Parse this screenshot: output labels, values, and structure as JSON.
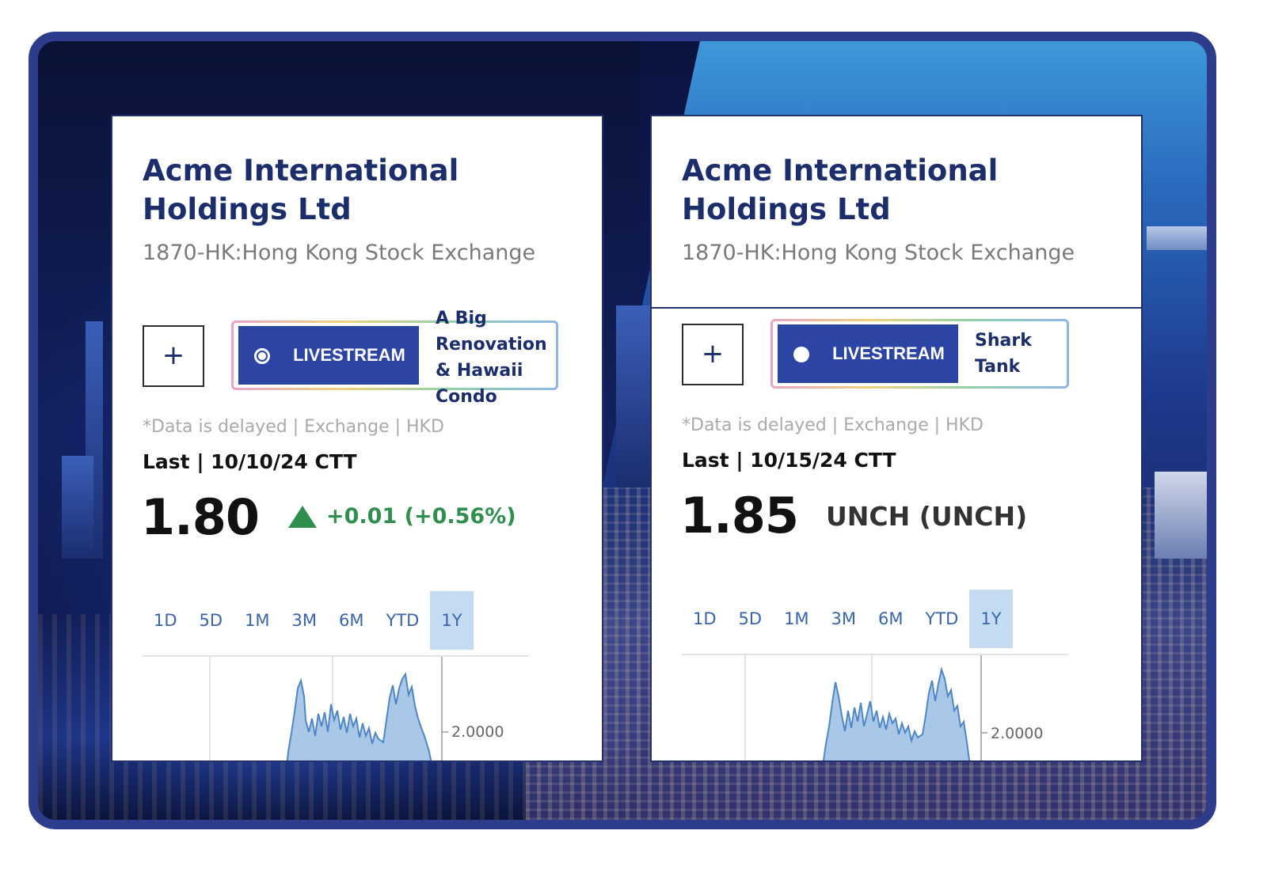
{
  "cards": [
    {
      "company": "Acme International Holdings Ltd",
      "exchange": "1870-HK:Hong Kong Stock Exchange",
      "plus_label": "+",
      "livestream_label": "LIVESTREAM",
      "livestream_topic": "A Big Renovation & Hawaii Condo",
      "delay_note": "*Data is delayed | Exchange | HKD",
      "last_label": "Last | 10/10/24 CTT",
      "price": "1.80",
      "change": "+0.01 (+0.56%)",
      "change_direction": "up",
      "ranges": [
        "1D",
        "5D",
        "1M",
        "3M",
        "6M",
        "YTD",
        "1Y"
      ],
      "active_range": "1Y",
      "chart_axis_label": "2.0000"
    },
    {
      "company": "Acme International Holdings Ltd",
      "exchange": "1870-HK:Hong Kong Stock Exchange",
      "plus_label": "+",
      "livestream_label": "LIVESTREAM",
      "livestream_topic": "Shark Tank",
      "delay_note": "*Data is delayed | Exchange | HKD",
      "last_label": "Last | 10/15/24 CTT",
      "price": "1.85",
      "change": "UNCH (UNCH)",
      "change_direction": "flat",
      "ranges": [
        "1D",
        "5D",
        "1M",
        "3M",
        "6M",
        "YTD",
        "1Y"
      ],
      "active_range": "1Y",
      "chart_axis_label": "2.0000"
    }
  ],
  "colors": {
    "frame_border": "#2e3c8c",
    "title": "#1b2d6b",
    "livestream_bg": "#2c45a5",
    "positive": "#2f8f4e",
    "range_text": "#3a64a8",
    "range_active_bg": "#c4dbf2",
    "chart_line": "#4f86c6",
    "chart_fill": "#a9c8e8"
  }
}
